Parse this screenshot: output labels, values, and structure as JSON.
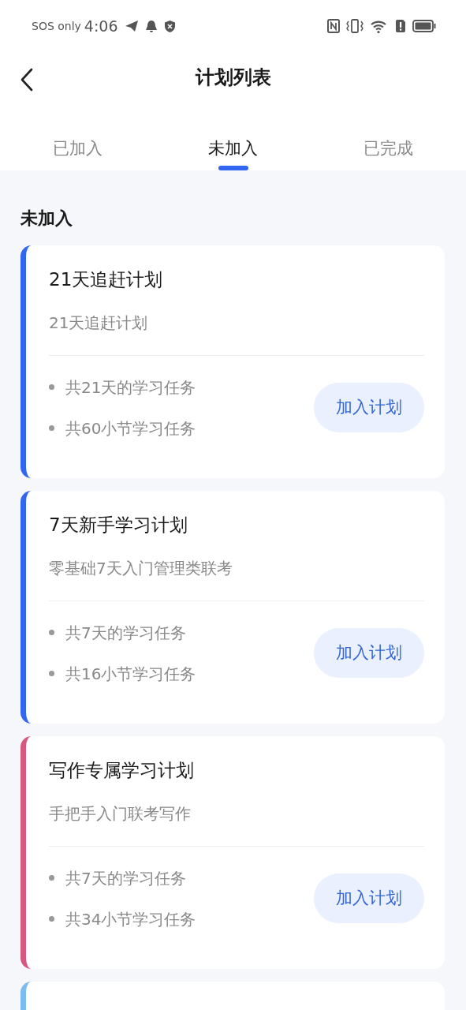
{
  "status_bar": {
    "carrier": "SOS only",
    "time": "4:06"
  },
  "header": {
    "title": "计划列表"
  },
  "tabs": [
    {
      "label": "已加入",
      "selected": false
    },
    {
      "label": "未加入",
      "selected": true
    },
    {
      "label": "已完成",
      "selected": false
    }
  ],
  "section_title": "未加入",
  "plans": [
    {
      "color": "#3366f0",
      "title": "21天追赶计划",
      "subtitle": "21天追赶计划",
      "details": [
        "共21天的学习任务",
        "共60小节学习任务"
      ],
      "button": "加入计划"
    },
    {
      "color": "#3366f0",
      "title": "7天新手学习计划",
      "subtitle": "零基础7天入门管理类联考",
      "details": [
        "共7天的学习任务",
        "共16小节学习任务"
      ],
      "button": "加入计划"
    },
    {
      "color": "#d9577f",
      "title": "写作专属学习计划",
      "subtitle": "手把手入门联考写作",
      "details": [
        "共7天的学习任务",
        "共34小节学习任务"
      ],
      "button": "加入计划"
    },
    {
      "color": "#7dbcf0"
    }
  ]
}
